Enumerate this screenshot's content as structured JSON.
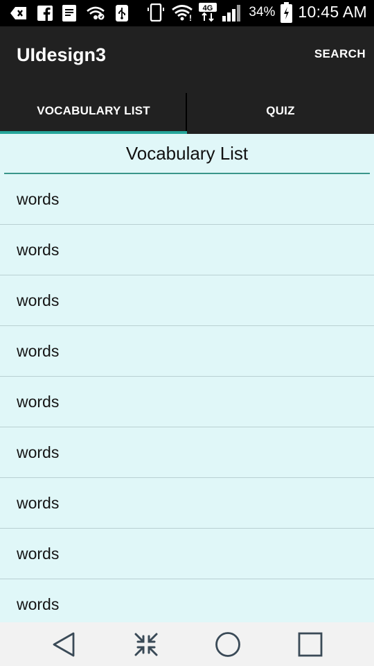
{
  "status_bar": {
    "battery_percent": "34%",
    "time": "10:45 AM",
    "network_label": "4G",
    "icons_left": [
      "back-arrow-notification-icon",
      "facebook-icon",
      "document-notification-icon",
      "wifi-calling-icon",
      "usb-icon"
    ],
    "icons_right": [
      "vibrate-icon",
      "wifi-icon",
      "network-4g-icon",
      "signal-icon",
      "battery-charging-icon"
    ]
  },
  "app_bar": {
    "title": "UIdesign3",
    "search_label": "SEARCH"
  },
  "tabs": [
    {
      "label": "VOCABULARY LIST",
      "selected": true
    },
    {
      "label": "QUIZ",
      "selected": false
    }
  ],
  "list": {
    "header": "Vocabulary List",
    "items": [
      "words",
      "words",
      "words",
      "words",
      "words",
      "words",
      "words",
      "words",
      "words"
    ]
  },
  "nav_bar": {
    "buttons": [
      "back-icon",
      "dual-window-icon",
      "home-icon",
      "recents-icon"
    ]
  },
  "colors": {
    "app_bar": "#212121",
    "accent": "#26a69a",
    "content_background": "#e0f7f8",
    "nav_bar": "#f2f2f2"
  }
}
